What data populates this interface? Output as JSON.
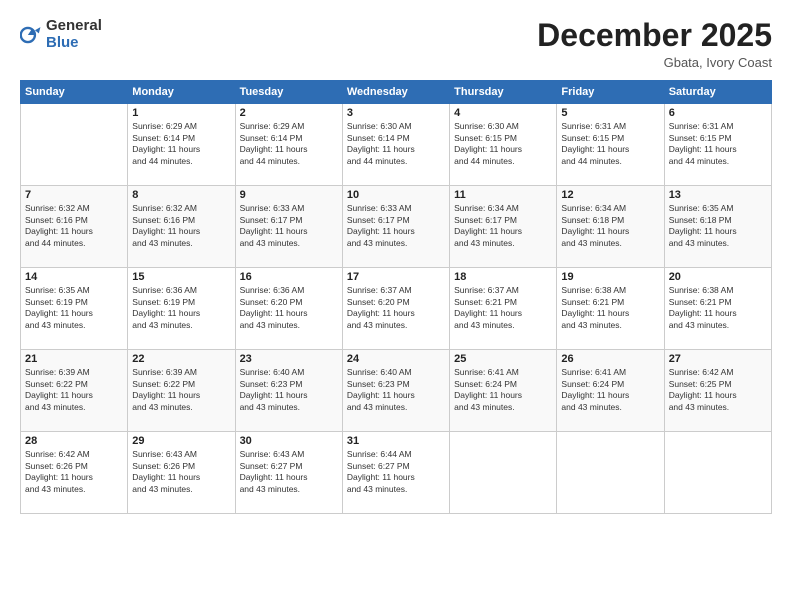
{
  "header": {
    "logo_general": "General",
    "logo_blue": "Blue",
    "month": "December 2025",
    "location": "Gbata, Ivory Coast"
  },
  "weekdays": [
    "Sunday",
    "Monday",
    "Tuesday",
    "Wednesday",
    "Thursday",
    "Friday",
    "Saturday"
  ],
  "weeks": [
    [
      {
        "day": "",
        "info": ""
      },
      {
        "day": "1",
        "info": "Sunrise: 6:29 AM\nSunset: 6:14 PM\nDaylight: 11 hours\nand 44 minutes."
      },
      {
        "day": "2",
        "info": "Sunrise: 6:29 AM\nSunset: 6:14 PM\nDaylight: 11 hours\nand 44 minutes."
      },
      {
        "day": "3",
        "info": "Sunrise: 6:30 AM\nSunset: 6:14 PM\nDaylight: 11 hours\nand 44 minutes."
      },
      {
        "day": "4",
        "info": "Sunrise: 6:30 AM\nSunset: 6:15 PM\nDaylight: 11 hours\nand 44 minutes."
      },
      {
        "day": "5",
        "info": "Sunrise: 6:31 AM\nSunset: 6:15 PM\nDaylight: 11 hours\nand 44 minutes."
      },
      {
        "day": "6",
        "info": "Sunrise: 6:31 AM\nSunset: 6:15 PM\nDaylight: 11 hours\nand 44 minutes."
      }
    ],
    [
      {
        "day": "7",
        "info": "Sunrise: 6:32 AM\nSunset: 6:16 PM\nDaylight: 11 hours\nand 44 minutes."
      },
      {
        "day": "8",
        "info": "Sunrise: 6:32 AM\nSunset: 6:16 PM\nDaylight: 11 hours\nand 43 minutes."
      },
      {
        "day": "9",
        "info": "Sunrise: 6:33 AM\nSunset: 6:17 PM\nDaylight: 11 hours\nand 43 minutes."
      },
      {
        "day": "10",
        "info": "Sunrise: 6:33 AM\nSunset: 6:17 PM\nDaylight: 11 hours\nand 43 minutes."
      },
      {
        "day": "11",
        "info": "Sunrise: 6:34 AM\nSunset: 6:17 PM\nDaylight: 11 hours\nand 43 minutes."
      },
      {
        "day": "12",
        "info": "Sunrise: 6:34 AM\nSunset: 6:18 PM\nDaylight: 11 hours\nand 43 minutes."
      },
      {
        "day": "13",
        "info": "Sunrise: 6:35 AM\nSunset: 6:18 PM\nDaylight: 11 hours\nand 43 minutes."
      }
    ],
    [
      {
        "day": "14",
        "info": "Sunrise: 6:35 AM\nSunset: 6:19 PM\nDaylight: 11 hours\nand 43 minutes."
      },
      {
        "day": "15",
        "info": "Sunrise: 6:36 AM\nSunset: 6:19 PM\nDaylight: 11 hours\nand 43 minutes."
      },
      {
        "day": "16",
        "info": "Sunrise: 6:36 AM\nSunset: 6:20 PM\nDaylight: 11 hours\nand 43 minutes."
      },
      {
        "day": "17",
        "info": "Sunrise: 6:37 AM\nSunset: 6:20 PM\nDaylight: 11 hours\nand 43 minutes."
      },
      {
        "day": "18",
        "info": "Sunrise: 6:37 AM\nSunset: 6:21 PM\nDaylight: 11 hours\nand 43 minutes."
      },
      {
        "day": "19",
        "info": "Sunrise: 6:38 AM\nSunset: 6:21 PM\nDaylight: 11 hours\nand 43 minutes."
      },
      {
        "day": "20",
        "info": "Sunrise: 6:38 AM\nSunset: 6:21 PM\nDaylight: 11 hours\nand 43 minutes."
      }
    ],
    [
      {
        "day": "21",
        "info": "Sunrise: 6:39 AM\nSunset: 6:22 PM\nDaylight: 11 hours\nand 43 minutes."
      },
      {
        "day": "22",
        "info": "Sunrise: 6:39 AM\nSunset: 6:22 PM\nDaylight: 11 hours\nand 43 minutes."
      },
      {
        "day": "23",
        "info": "Sunrise: 6:40 AM\nSunset: 6:23 PM\nDaylight: 11 hours\nand 43 minutes."
      },
      {
        "day": "24",
        "info": "Sunrise: 6:40 AM\nSunset: 6:23 PM\nDaylight: 11 hours\nand 43 minutes."
      },
      {
        "day": "25",
        "info": "Sunrise: 6:41 AM\nSunset: 6:24 PM\nDaylight: 11 hours\nand 43 minutes."
      },
      {
        "day": "26",
        "info": "Sunrise: 6:41 AM\nSunset: 6:24 PM\nDaylight: 11 hours\nand 43 minutes."
      },
      {
        "day": "27",
        "info": "Sunrise: 6:42 AM\nSunset: 6:25 PM\nDaylight: 11 hours\nand 43 minutes."
      }
    ],
    [
      {
        "day": "28",
        "info": "Sunrise: 6:42 AM\nSunset: 6:26 PM\nDaylight: 11 hours\nand 43 minutes."
      },
      {
        "day": "29",
        "info": "Sunrise: 6:43 AM\nSunset: 6:26 PM\nDaylight: 11 hours\nand 43 minutes."
      },
      {
        "day": "30",
        "info": "Sunrise: 6:43 AM\nSunset: 6:27 PM\nDaylight: 11 hours\nand 43 minutes."
      },
      {
        "day": "31",
        "info": "Sunrise: 6:44 AM\nSunset: 6:27 PM\nDaylight: 11 hours\nand 43 minutes."
      },
      {
        "day": "",
        "info": ""
      },
      {
        "day": "",
        "info": ""
      },
      {
        "day": "",
        "info": ""
      }
    ]
  ]
}
